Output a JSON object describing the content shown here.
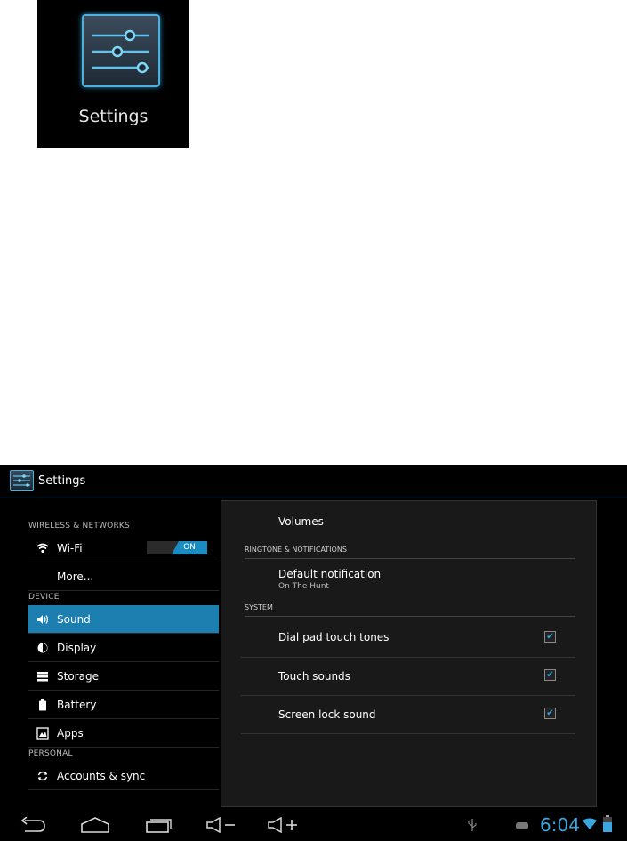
{
  "launcher": {
    "label": "Settings",
    "icon": "settings-sliders-icon"
  },
  "actionbar": {
    "title": "Settings"
  },
  "left": {
    "wireless_header": "WIRELESS & NETWORKS",
    "wifi_label": "Wi-Fi",
    "wifi_toggle": "ON",
    "more_label": "More...",
    "device_header": "DEVICE",
    "sound_label": "Sound",
    "display_label": "Display",
    "storage_label": "Storage",
    "battery_label": "Battery",
    "apps_label": "Apps",
    "personal_header": "PERSONAL",
    "accounts_label": "Accounts & sync"
  },
  "right": {
    "volumes_label": "Volumes",
    "ringtone_header": "RINGTONE & NOTIFICATIONS",
    "notification_title": "Default notification",
    "notification_value": "On The Hunt",
    "system_header": "SYSTEM",
    "dialpad_label": "Dial pad touch tones",
    "touch_label": "Touch sounds",
    "screenlock_label": "Screen lock sound"
  },
  "status": {
    "time": "6:04"
  },
  "colors": {
    "accent": "#1c7fb0",
    "clock": "#3aa8e0"
  }
}
